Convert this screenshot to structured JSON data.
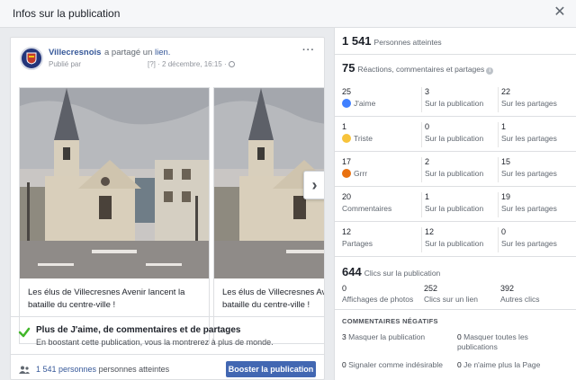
{
  "dialog": {
    "title": "Infos sur la publication",
    "close_glyph": "✕"
  },
  "post": {
    "page_name": "Villecresnois",
    "shared_prefix": "a partagé un",
    "shared_link": "lien.",
    "published_by": "Publié par",
    "bracket": "[?]",
    "date": "· 2 décembre, 16:15 ·",
    "more_glyph": "···",
    "cards": [
      {
        "caption": "Les élus de Villecresnes Avenir lancent la bataille du centre-ville !"
      },
      {
        "caption": "Les élus de Villecresnes Avenir lancent la bataille du centre-ville !"
      }
    ],
    "next_glyph": "›",
    "boost_title": "Plus de J'aime, de commentaires et de partages",
    "boost_sub": "En boostant cette publication, vous la montrerez à plus de monde.",
    "reach_count": "1 541 personnes",
    "reach_label": "personnes atteintes",
    "boost_button": "Booster la publication"
  },
  "stats": {
    "reach_value": "1 541",
    "reach_label": "Personnes atteintes",
    "reactions_value": "75",
    "reactions_label": "Réactions, commentaires et partages",
    "rows": [
      {
        "c1n": "25",
        "c1l": "J'aime",
        "icon": "like-icon",
        "c2n": "3",
        "c2l": "Sur la publication",
        "c3n": "22",
        "c3l": "Sur les partages"
      },
      {
        "c1n": "1",
        "c1l": "Triste",
        "icon": "sad-icon",
        "c2n": "0",
        "c2l": "Sur la publication",
        "c3n": "1",
        "c3l": "Sur les partages"
      },
      {
        "c1n": "17",
        "c1l": "Grrr",
        "icon": "angry-icon",
        "c2n": "2",
        "c2l": "Sur la publication",
        "c3n": "15",
        "c3l": "Sur les partages"
      },
      {
        "c1n": "20",
        "c1l": "Commentaires",
        "icon": "",
        "c2n": "1",
        "c2l": "Sur la publication",
        "c3n": "19",
        "c3l": "Sur les partages"
      },
      {
        "c1n": "12",
        "c1l": "Partages",
        "icon": "",
        "c2n": "12",
        "c2l": "Sur la publication",
        "c3n": "0",
        "c3l": "Sur les partages"
      }
    ],
    "clicks_value": "644",
    "clicks_label": "Clics sur la publication",
    "clicks": [
      {
        "n": "0",
        "l": "Affichages de photos"
      },
      {
        "n": "252",
        "l": "Clics sur un lien"
      },
      {
        "n": "392",
        "l": "Autres clics"
      }
    ],
    "negative_title": "COMMENTAIRES NÉGATIFS",
    "negative": [
      {
        "n": "3",
        "l": "Masquer la publication"
      },
      {
        "n": "0",
        "l": "Masquer toutes les publications"
      },
      {
        "n": "0",
        "l": "Signaler comme indésirable"
      },
      {
        "n": "0",
        "l": "Je n'aime plus la Page"
      }
    ],
    "colors": {
      "like": "#4080ff",
      "sad": "#f7c33b",
      "angry": "#e9710f",
      "link": "#365899",
      "button": "#4267b2",
      "check": "#42b72a"
    }
  }
}
